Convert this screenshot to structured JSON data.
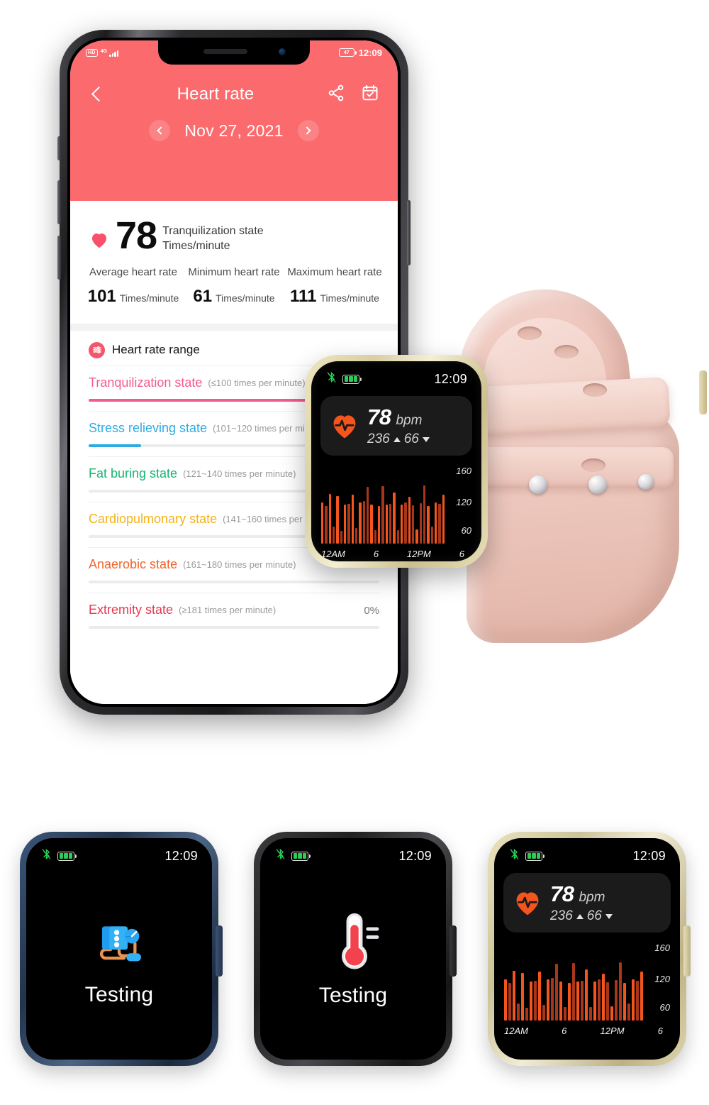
{
  "phone": {
    "status_bar": {
      "hd_badge": "HD",
      "network": "4G",
      "battery_level": "47",
      "time": "12:09"
    },
    "header": {
      "back_icon": "back-chevron-icon",
      "title": "Heart rate",
      "share_icon": "share-icon",
      "calendar_icon": "calendar-check-icon",
      "date": "Nov 27, 2021",
      "prev_icon": "chevron-left-icon",
      "next_icon": "chevron-right-icon",
      "accent": "#fb6b6e"
    },
    "current": {
      "heart_icon": "heart-icon",
      "value": "78",
      "state": "Tranquilization state",
      "unit": "Times/minute"
    },
    "stats": [
      {
        "label": "Average heart rate",
        "value": "101",
        "unit": "Times/minute"
      },
      {
        "label": "Minimum heart rate",
        "value": "61",
        "unit": "Times/minute"
      },
      {
        "label": "Maximum heart rate",
        "value": "111",
        "unit": "Times/minute"
      }
    ],
    "range_section": {
      "icon": "sliders-icon",
      "title": "Heart rate range",
      "items": [
        {
          "name": "Tranquilization state",
          "sub": "(≤100 times per minute)",
          "pct": "",
          "fill": 100,
          "color": "#f25c8a"
        },
        {
          "name": "Stress relieving state",
          "sub": "(101~120 times per minute)",
          "pct": "",
          "fill": 18,
          "color": "#2eabe2"
        },
        {
          "name": "Fat buring state",
          "sub": "(121~140 times per minute)",
          "pct": "",
          "fill": 0,
          "color": "#17b472"
        },
        {
          "name": "Cardiopulmonary state",
          "sub": "(141~160 times per minute)",
          "pct": "",
          "fill": 0,
          "color": "#f2b318"
        },
        {
          "name": "Anaerobic state",
          "sub": "(161~180 times per minute)",
          "pct": "",
          "fill": 0,
          "color": "#f0642a"
        },
        {
          "name": "Extremity state",
          "sub": "(≥181 times per minute)",
          "pct": "0%",
          "fill": 0,
          "color": "#e8384f"
        }
      ]
    }
  },
  "watch_main": {
    "case_color": "#e3d9ae",
    "band_color": "#eec7bd",
    "status": {
      "bluetooth_icon": "bluetooth-disconnected-icon",
      "battery_icon": "battery-icon",
      "time": "12:09"
    },
    "hr_card": {
      "heart_icon": "heart-pulse-icon",
      "value": "78",
      "unit": "bpm",
      "max": "236",
      "min": "66",
      "up_icon": "triangle-up-icon",
      "down_icon": "triangle-down-icon"
    },
    "chart_data": {
      "type": "bar",
      "title": "",
      "xlabel": "",
      "ylabel": "",
      "ylim": [
        40,
        170
      ],
      "yticks": [
        "160",
        "120",
        "60"
      ],
      "xticks": [
        "12AM",
        "6",
        "12PM",
        "6"
      ],
      "grid": false,
      "values": [
        118,
        112,
        135,
        72,
        131,
        64,
        114,
        116,
        134,
        70,
        118,
        121,
        148,
        115,
        66,
        112,
        150,
        114,
        116,
        138,
        66,
        115,
        118,
        130,
        113,
        67,
        117,
        151,
        112,
        73,
        119,
        116,
        133
      ],
      "colors": [
        "#f4541d",
        "#a8361a",
        "#f4541d",
        "#a8361a",
        "#f4541d",
        "#a8361a",
        "#f4541d",
        "#a8361a",
        "#f4541d",
        "#a8361a",
        "#f4541d",
        "#a8361a",
        "#a8361a",
        "#f4541d",
        "#a8361a",
        "#f4541d",
        "#a8361a",
        "#f4541d",
        "#a8361a",
        "#f4541d",
        "#a8361a",
        "#f4541d",
        "#a8361a",
        "#f4541d",
        "#a8361a",
        "#f4541d",
        "#a8361a",
        "#a8361a",
        "#f4541d",
        "#a8361a",
        "#f4541d",
        "#a8361a",
        "#f4541d"
      ]
    }
  },
  "bottom_watches": [
    {
      "case_color": "#2d4464",
      "status": {
        "bluetooth_icon": "bluetooth-disconnected-icon",
        "battery_icon": "battery-icon",
        "time": "12:09"
      },
      "icon": "blood-pressure-monitor-icon",
      "label": "Testing"
    },
    {
      "case_color": "#2a2a2c",
      "status": {
        "bluetooth_icon": "bluetooth-disconnected-icon",
        "battery_icon": "battery-icon",
        "time": "12:09"
      },
      "icon": "thermometer-icon",
      "label": "Testing"
    },
    {
      "case_color": "#d9d3ad",
      "status": {
        "bluetooth_icon": "bluetooth-disconnected-icon",
        "battery_icon": "battery-icon",
        "time": "12:09"
      },
      "hr_card": {
        "heart_icon": "heart-pulse-icon",
        "value": "78",
        "unit": "bpm",
        "max": "236",
        "min": "66",
        "up_icon": "triangle-up-icon",
        "down_icon": "triangle-down-icon"
      },
      "chart_data": {
        "type": "bar",
        "ylim": [
          40,
          170
        ],
        "yticks": [
          "160",
          "120",
          "60"
        ],
        "xticks": [
          "12AM",
          "6",
          "12PM",
          "6"
        ],
        "grid": false,
        "values": [
          118,
          112,
          135,
          72,
          131,
          64,
          114,
          116,
          134,
          70,
          118,
          121,
          148,
          115,
          66,
          112,
          150,
          114,
          116,
          138,
          66,
          115,
          118,
          130,
          113,
          67,
          117,
          151,
          112,
          73,
          119,
          116,
          133
        ],
        "colors": [
          "#f4541d",
          "#a8361a",
          "#f4541d",
          "#a8361a",
          "#f4541d",
          "#a8361a",
          "#f4541d",
          "#a8361a",
          "#f4541d",
          "#a8361a",
          "#f4541d",
          "#a8361a",
          "#a8361a",
          "#f4541d",
          "#a8361a",
          "#f4541d",
          "#a8361a",
          "#f4541d",
          "#a8361a",
          "#f4541d",
          "#a8361a",
          "#f4541d",
          "#a8361a",
          "#f4541d",
          "#a8361a",
          "#f4541d",
          "#a8361a",
          "#a8361a",
          "#f4541d",
          "#a8361a",
          "#f4541d",
          "#a8361a",
          "#f4541d"
        ]
      }
    }
  ]
}
